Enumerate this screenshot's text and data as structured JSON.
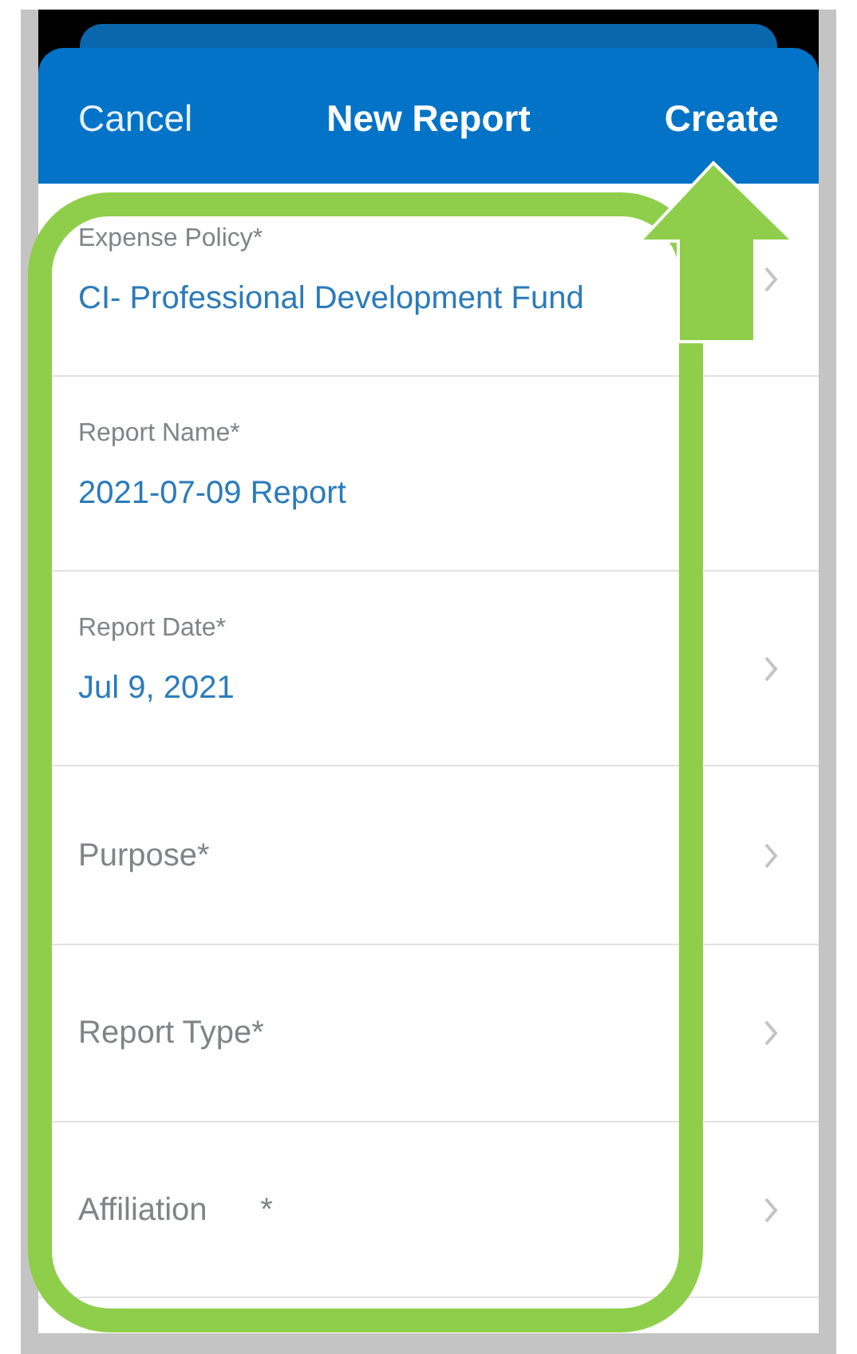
{
  "header": {
    "cancel": "Cancel",
    "title": "New Report",
    "create": "Create"
  },
  "fields": [
    {
      "label": "Expense Policy*",
      "value": "CI- Professional Development Fund",
      "chevron": true
    },
    {
      "label": "Report Name*",
      "value": "2021-07-09 Report",
      "chevron": false
    },
    {
      "label": "Report Date*",
      "value": "Jul 9, 2021",
      "chevron": true
    },
    {
      "label": "Purpose*",
      "chevron": true
    },
    {
      "label": "Report Type*",
      "chevron": true
    },
    {
      "label": "Affiliation      *",
      "chevron": true
    }
  ]
}
